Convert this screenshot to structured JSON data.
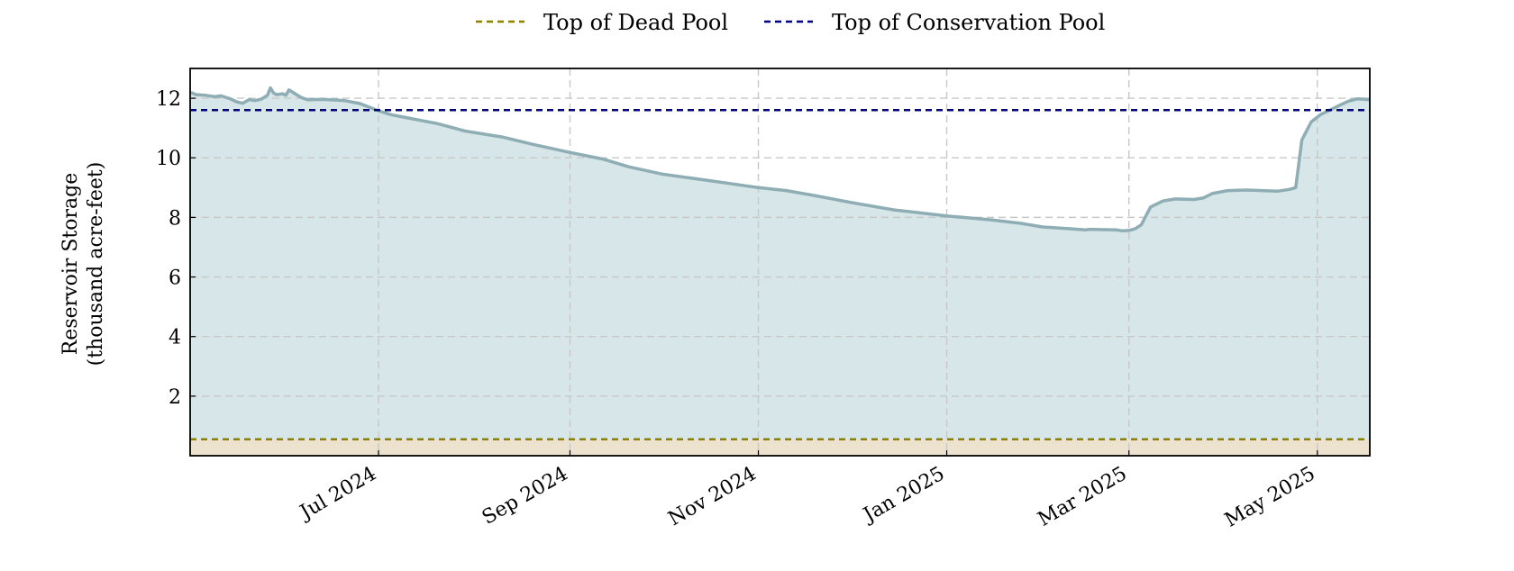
{
  "chart_data": {
    "type": "area",
    "title": "",
    "xlabel": "",
    "ylabel": "Reservoir Storage",
    "ylabel_line2": "(thousand acre-feet)",
    "x_start": "2024-05-01",
    "x_end": "2025-05-18",
    "ylim": [
      0,
      13
    ],
    "yticks": [
      2,
      4,
      6,
      8,
      10,
      12
    ],
    "xticks": [
      {
        "date": "2024-07-01",
        "label": "Jul 2024"
      },
      {
        "date": "2024-09-01",
        "label": "Sep 2024"
      },
      {
        "date": "2024-11-01",
        "label": "Nov 2024"
      },
      {
        "date": "2025-01-01",
        "label": "Jan 2025"
      },
      {
        "date": "2025-03-01",
        "label": "Mar 2025"
      },
      {
        "date": "2025-05-01",
        "label": "May 2025"
      }
    ],
    "grid": true,
    "legend_position": "top-center",
    "series": [
      {
        "key": "storage",
        "style": "filled-line",
        "color": "#8fadb4",
        "fill": "#d7e6e8",
        "points": [
          [
            "2024-05-01",
            12.2
          ],
          [
            "2024-05-03",
            12.12
          ],
          [
            "2024-05-06",
            12.1
          ],
          [
            "2024-05-09",
            12.05
          ],
          [
            "2024-05-11",
            12.08
          ],
          [
            "2024-05-14",
            11.98
          ],
          [
            "2024-05-16",
            11.88
          ],
          [
            "2024-05-18",
            11.83
          ],
          [
            "2024-05-20",
            11.95
          ],
          [
            "2024-05-22",
            11.92
          ],
          [
            "2024-05-24",
            11.97
          ],
          [
            "2024-05-26",
            12.1
          ],
          [
            "2024-05-27",
            12.35
          ],
          [
            "2024-05-28",
            12.18
          ],
          [
            "2024-05-29",
            12.12
          ],
          [
            "2024-05-31",
            12.15
          ],
          [
            "2024-06-01",
            12.1
          ],
          [
            "2024-06-02",
            12.28
          ],
          [
            "2024-06-04",
            12.15
          ],
          [
            "2024-06-06",
            12.02
          ],
          [
            "2024-06-08",
            11.95
          ],
          [
            "2024-06-13",
            11.96
          ],
          [
            "2024-06-20",
            11.92
          ],
          [
            "2024-06-25",
            11.82
          ],
          [
            "2024-07-01",
            11.58
          ],
          [
            "2024-07-05",
            11.45
          ],
          [
            "2024-07-10",
            11.35
          ],
          [
            "2024-07-20",
            11.15
          ],
          [
            "2024-07-29",
            10.9
          ],
          [
            "2024-08-10",
            10.7
          ],
          [
            "2024-08-20",
            10.45
          ],
          [
            "2024-09-01",
            10.18
          ],
          [
            "2024-09-12",
            9.95
          ],
          [
            "2024-09-20",
            9.7
          ],
          [
            "2024-10-01",
            9.45
          ],
          [
            "2024-10-15",
            9.25
          ],
          [
            "2024-11-01",
            9.0
          ],
          [
            "2024-11-10",
            8.9
          ],
          [
            "2024-11-20",
            8.72
          ],
          [
            "2024-12-01",
            8.5
          ],
          [
            "2024-12-15",
            8.25
          ],
          [
            "2025-01-01",
            8.05
          ],
          [
            "2025-01-15",
            7.92
          ],
          [
            "2025-01-25",
            7.8
          ],
          [
            "2025-02-01",
            7.68
          ],
          [
            "2025-02-10",
            7.62
          ],
          [
            "2025-02-15",
            7.58
          ],
          [
            "2025-02-16",
            7.6
          ],
          [
            "2025-02-25",
            7.58
          ],
          [
            "2025-02-27",
            7.55
          ],
          [
            "2025-03-01",
            7.56
          ],
          [
            "2025-03-03",
            7.62
          ],
          [
            "2025-03-05",
            7.75
          ],
          [
            "2025-03-08",
            8.35
          ],
          [
            "2025-03-12",
            8.55
          ],
          [
            "2025-03-16",
            8.62
          ],
          [
            "2025-03-22",
            8.6
          ],
          [
            "2025-03-25",
            8.65
          ],
          [
            "2025-03-28",
            8.8
          ],
          [
            "2025-04-02",
            8.9
          ],
          [
            "2025-04-08",
            8.92
          ],
          [
            "2025-04-13",
            8.9
          ],
          [
            "2025-04-18",
            8.88
          ],
          [
            "2025-04-22",
            8.94
          ],
          [
            "2025-04-24",
            9.0
          ],
          [
            "2025-04-25",
            9.8
          ],
          [
            "2025-04-26",
            10.6
          ],
          [
            "2025-04-29",
            11.2
          ],
          [
            "2025-05-02",
            11.45
          ],
          [
            "2025-05-05",
            11.6
          ],
          [
            "2025-05-08",
            11.75
          ],
          [
            "2025-05-11",
            11.9
          ],
          [
            "2025-05-14",
            11.98
          ],
          [
            "2025-05-16",
            11.97
          ],
          [
            "2025-05-18",
            11.95
          ]
        ]
      },
      {
        "key": "dead_pool",
        "name": "Top of Dead Pool",
        "style": "dashed-line",
        "color": "#8b8000",
        "fill": "#ece2cd",
        "value": 0.55
      },
      {
        "key": "conservation_pool",
        "name": "Top of Conservation Pool",
        "style": "dashed-line",
        "color": "#00007f",
        "value": 11.6
      }
    ]
  }
}
